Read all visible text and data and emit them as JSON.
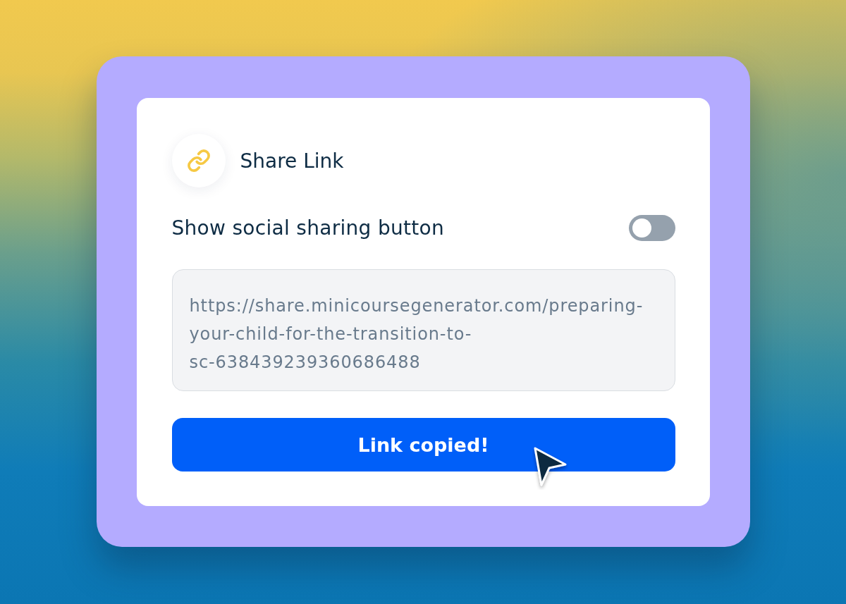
{
  "dialog": {
    "title": "Share Link"
  },
  "social_sharing": {
    "label": "Show social sharing button",
    "on": false
  },
  "url_field": {
    "value": "https://share.minicoursegenerator.com/preparing-your-child-for-the-transition-to-sc-638439239360686488"
  },
  "copy_button": {
    "label": "Link copied!"
  }
}
